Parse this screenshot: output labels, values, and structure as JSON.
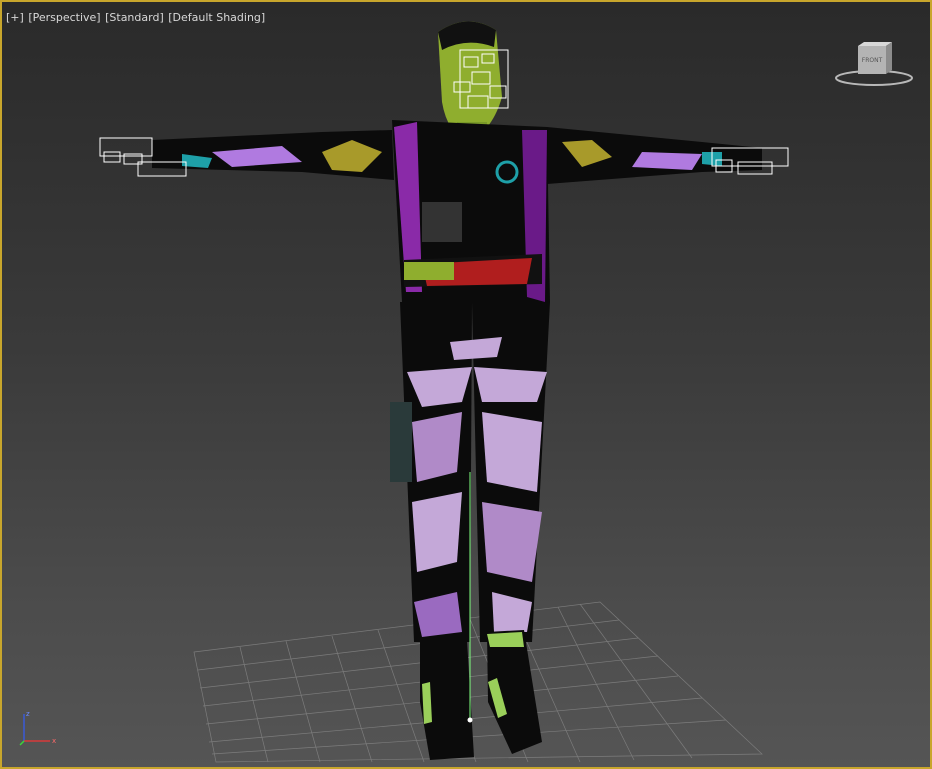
{
  "viewport": {
    "labels": {
      "menu": "[+]",
      "view": "[Perspective]",
      "mode": "[Standard]",
      "shading": "[Default Shading]"
    },
    "viewcube": {
      "face_label": "FRONT"
    },
    "axis_tripod": {
      "x": "x",
      "z": "z"
    },
    "colors": {
      "active_border": "#c8a62c",
      "grid": "#8a8a8a",
      "pivot": "#7fff7f"
    }
  }
}
